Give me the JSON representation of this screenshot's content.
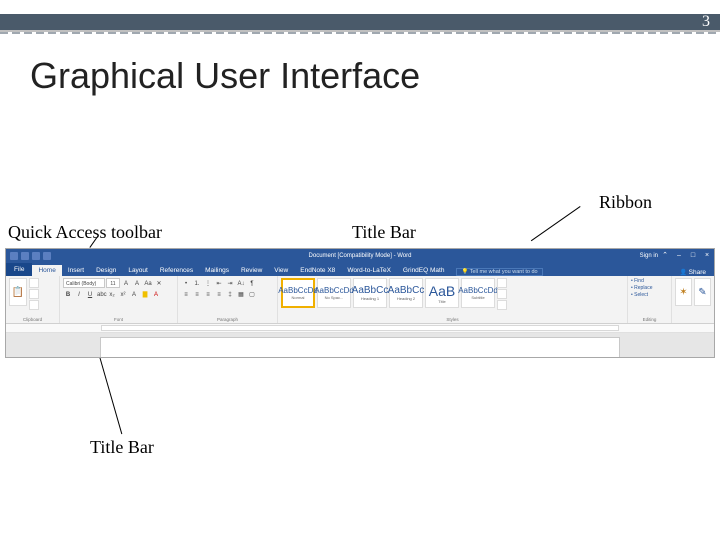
{
  "slide": {
    "number": "3",
    "title": "Graphical User Interface"
  },
  "labels": {
    "ribbon": "Ribbon",
    "qat": "Quick Access toolbar",
    "title_bar_top": "Title Bar",
    "title_bar_bottom": "Title Bar"
  },
  "word": {
    "doc_title": "Document [Compatibility Mode] - Word",
    "sign_in": "Sign in",
    "share": "Share",
    "file": "File",
    "tabs": [
      "Home",
      "Insert",
      "Design",
      "Layout",
      "References",
      "Mailings",
      "Review",
      "View",
      "EndNote X8",
      "Word-to-LaTeX",
      "GrindEQ Math"
    ],
    "tell_me": "Tell me what you want to do",
    "groups": {
      "clipboard": "Clipboard",
      "font": "Font",
      "paragraph": "Paragraph",
      "styles": "Styles",
      "editing": "Editing"
    },
    "paste": "📋",
    "format_painter": "Format Painter",
    "font_name": "Calibri (Body)",
    "font_size": "11",
    "styles": [
      {
        "sample": "AaBbCcDd",
        "name": "Normal"
      },
      {
        "sample": "AaBbCcDd",
        "name": "No Spac..."
      },
      {
        "sample": "AaBbCc",
        "name": "Heading 1"
      },
      {
        "sample": "AaBbCc",
        "name": "Heading 2"
      },
      {
        "sample": "AaB",
        "name": "Title"
      },
      {
        "sample": "AaBbCcDd",
        "name": "Subtitle"
      }
    ],
    "editing": {
      "find": "Find",
      "replace": "Replace",
      "select": "Select"
    }
  }
}
